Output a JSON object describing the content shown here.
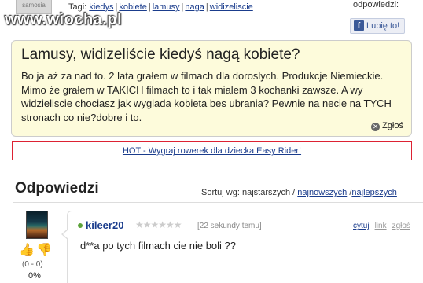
{
  "watermark": {
    "brand": "www.wiocha.pl",
    "thumb_label": "samosia"
  },
  "tags": {
    "label": "Tagi:",
    "items": [
      "kiedys",
      "kobiete",
      "lamusy",
      "naga",
      "widizeliscie"
    ]
  },
  "sidebar": {
    "answers_label": "odpowiedzi:",
    "like_label": "Lubię to!"
  },
  "question": {
    "title": "Lamusy, widizeliście kiedyś nagą kobiete?",
    "body": "Bo ja aż za nad to. 2 lata grałem w filmach dla doroslych. Produkcje Niemieckie. Mimo że grałem w TAKICH filmach to i tak mialem 3 kochanki zawsze. A wy widzieliscie chociasz jak wyglada kobieta bes ubrania? Pewnie na necie na TYCH stronach co nie?dobre i to.",
    "report_label": "Zgłoś"
  },
  "promo": {
    "label": "HOT - Wygraj rowerek dla dziecka Easy Rider!"
  },
  "answers": {
    "title": "Odpowiedzi",
    "sort_label": "Sortuj wg: najstarszych /",
    "sort_newest": "najnowszych",
    "sort_sep": "/",
    "sort_best": "najlepszych",
    "items": [
      {
        "user": "kileer20",
        "stars": "★★★★★★",
        "time": "[22 sekundy temu]",
        "quote": "cytuj",
        "link": "link",
        "report": "zgłoś",
        "text": "d**a po tych filmach cie nie boli ??",
        "votes": "(0 - 0)",
        "percent": "0%"
      }
    ]
  },
  "colors": {
    "link": "#1a3c8c",
    "question_bg": "#fdfbdb",
    "promo_border": "#dd2233"
  }
}
